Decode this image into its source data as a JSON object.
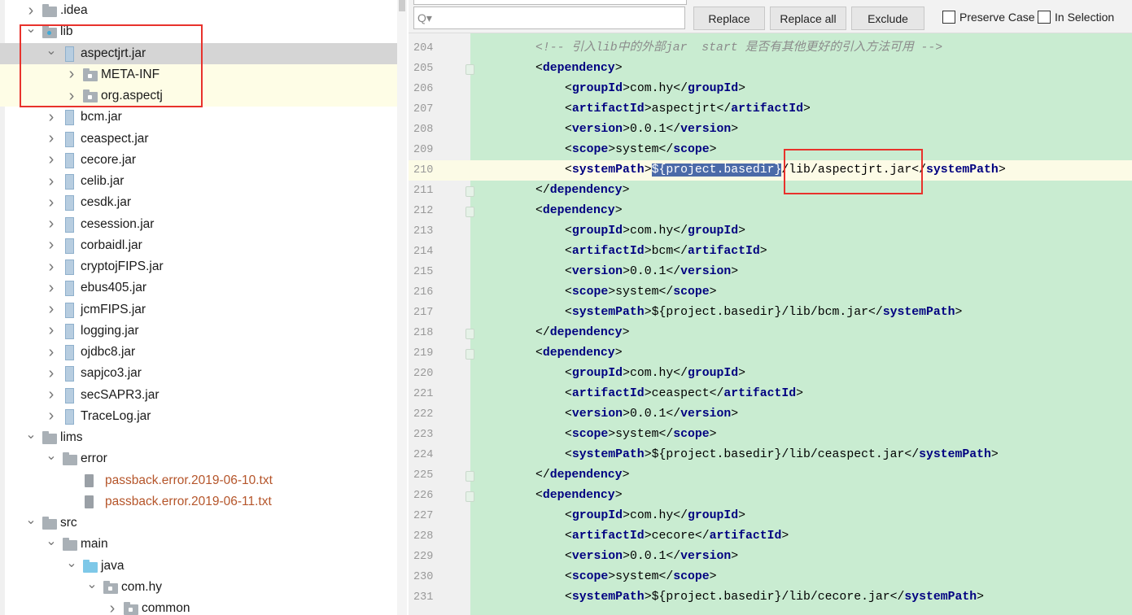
{
  "tree": [
    {
      "label": ".idea",
      "level": 0,
      "arrow": "right",
      "icon": "folder"
    },
    {
      "label": "lib",
      "level": 0,
      "arrow": "down",
      "icon": "library-folder"
    },
    {
      "label": "aspectjrt.jar",
      "level": 1,
      "arrow": "down",
      "icon": "jar",
      "selected": true
    },
    {
      "label": "META-INF",
      "level": 2,
      "arrow": "right",
      "icon": "package"
    },
    {
      "label": "org.aspectj",
      "level": 2,
      "arrow": "right",
      "icon": "package"
    },
    {
      "label": "bcm.jar",
      "level": 1,
      "arrow": "right",
      "icon": "jar"
    },
    {
      "label": "ceaspect.jar",
      "level": 1,
      "arrow": "right",
      "icon": "jar"
    },
    {
      "label": "cecore.jar",
      "level": 1,
      "arrow": "right",
      "icon": "jar"
    },
    {
      "label": "celib.jar",
      "level": 1,
      "arrow": "right",
      "icon": "jar"
    },
    {
      "label": "cesdk.jar",
      "level": 1,
      "arrow": "right",
      "icon": "jar"
    },
    {
      "label": "cesession.jar",
      "level": 1,
      "arrow": "right",
      "icon": "jar"
    },
    {
      "label": "corbaidl.jar",
      "level": 1,
      "arrow": "right",
      "icon": "jar"
    },
    {
      "label": "cryptojFIPS.jar",
      "level": 1,
      "arrow": "right",
      "icon": "jar"
    },
    {
      "label": "ebus405.jar",
      "level": 1,
      "arrow": "right",
      "icon": "jar"
    },
    {
      "label": "jcmFIPS.jar",
      "level": 1,
      "arrow": "right",
      "icon": "jar"
    },
    {
      "label": "logging.jar",
      "level": 1,
      "arrow": "right",
      "icon": "jar"
    },
    {
      "label": "ojdbc8.jar",
      "level": 1,
      "arrow": "right",
      "icon": "jar"
    },
    {
      "label": "sapjco3.jar",
      "level": 1,
      "arrow": "right",
      "icon": "jar"
    },
    {
      "label": "secSAPR3.jar",
      "level": 1,
      "arrow": "right",
      "icon": "jar"
    },
    {
      "label": "TraceLog.jar",
      "level": 1,
      "arrow": "right",
      "icon": "jar"
    },
    {
      "label": "lims",
      "level": 0,
      "arrow": "down",
      "icon": "folder"
    },
    {
      "label": "error",
      "level": 1,
      "arrow": "down",
      "icon": "folder"
    },
    {
      "label": "passback.error.2019-06-10.txt",
      "level": 2,
      "arrow": "",
      "icon": "text-file",
      "status": "error"
    },
    {
      "label": "passback.error.2019-06-11.txt",
      "level": 2,
      "arrow": "",
      "icon": "text-file",
      "status": "error"
    },
    {
      "label": "src",
      "level": 0,
      "arrow": "down",
      "icon": "folder"
    },
    {
      "label": "main",
      "level": 1,
      "arrow": "down",
      "icon": "folder"
    },
    {
      "label": "java",
      "level": 2,
      "arrow": "down",
      "icon": "source-folder"
    },
    {
      "label": "com.hy",
      "level": 3,
      "arrow": "down",
      "icon": "package"
    },
    {
      "label": "common",
      "level": 4,
      "arrow": "right",
      "icon": "package"
    }
  ],
  "findbar": {
    "search_placeholder": "Q▾",
    "replace": "Replace",
    "replace_all": "Replace all",
    "exclude": "Exclude",
    "preserve_case": "Preserve Case",
    "in_selection": "In Selection",
    "preserve_case_checked": false,
    "in_selection_checked": false
  },
  "editor": {
    "current_line": 210,
    "lines": [
      {
        "n": "204",
        "indent": 0,
        "text": "<!-- 引入lib中的外部jar  start 是否有其他更好的引入方法可用 -->",
        "comment": true
      },
      {
        "n": "205",
        "indent": 0,
        "text": "<dependency>"
      },
      {
        "n": "206",
        "indent": 1,
        "text": "<groupId>com.hy</groupId>"
      },
      {
        "n": "207",
        "indent": 1,
        "text": "<artifactId>aspectjrt</artifactId>"
      },
      {
        "n": "208",
        "indent": 1,
        "text": "<version>0.0.1</version>"
      },
      {
        "n": "209",
        "indent": 1,
        "text": "<scope>system</scope>"
      },
      {
        "n": "210",
        "indent": 1,
        "text": "<systemPath>${project.basedir}/lib/aspectjrt.jar</systemPath>",
        "selection": "${project.basedir}"
      },
      {
        "n": "211",
        "indent": 0,
        "text": "</dependency>"
      },
      {
        "n": "212",
        "indent": 0,
        "text": "<dependency>"
      },
      {
        "n": "213",
        "indent": 1,
        "text": "<groupId>com.hy</groupId>"
      },
      {
        "n": "214",
        "indent": 1,
        "text": "<artifactId>bcm</artifactId>"
      },
      {
        "n": "215",
        "indent": 1,
        "text": "<version>0.0.1</version>"
      },
      {
        "n": "216",
        "indent": 1,
        "text": "<scope>system</scope>"
      },
      {
        "n": "217",
        "indent": 1,
        "text": "<systemPath>${project.basedir}/lib/bcm.jar</systemPath>"
      },
      {
        "n": "218",
        "indent": 0,
        "text": "</dependency>"
      },
      {
        "n": "219",
        "indent": 0,
        "text": "<dependency>"
      },
      {
        "n": "220",
        "indent": 1,
        "text": "<groupId>com.hy</groupId>"
      },
      {
        "n": "221",
        "indent": 1,
        "text": "<artifactId>ceaspect</artifactId>"
      },
      {
        "n": "222",
        "indent": 1,
        "text": "<version>0.0.1</version>"
      },
      {
        "n": "223",
        "indent": 1,
        "text": "<scope>system</scope>"
      },
      {
        "n": "224",
        "indent": 1,
        "text": "<systemPath>${project.basedir}/lib/ceaspect.jar</systemPath>"
      },
      {
        "n": "225",
        "indent": 0,
        "text": "</dependency>"
      },
      {
        "n": "226",
        "indent": 0,
        "text": "<dependency>"
      },
      {
        "n": "227",
        "indent": 1,
        "text": "<groupId>com.hy</groupId>"
      },
      {
        "n": "228",
        "indent": 1,
        "text": "<artifactId>cecore</artifactId>"
      },
      {
        "n": "229",
        "indent": 1,
        "text": "<version>0.0.1</version>"
      },
      {
        "n": "230",
        "indent": 1,
        "text": "<scope>system</scope>"
      },
      {
        "n": "231",
        "indent": 1,
        "text": "<systemPath>${project.basedir}/lib/cecore.jar</systemPath>"
      }
    ]
  },
  "colors": {
    "annotation_box": "#e8322c",
    "editor_bg": "#c9ecd1",
    "selection": "#4b6aa8",
    "tag": "#000080"
  }
}
